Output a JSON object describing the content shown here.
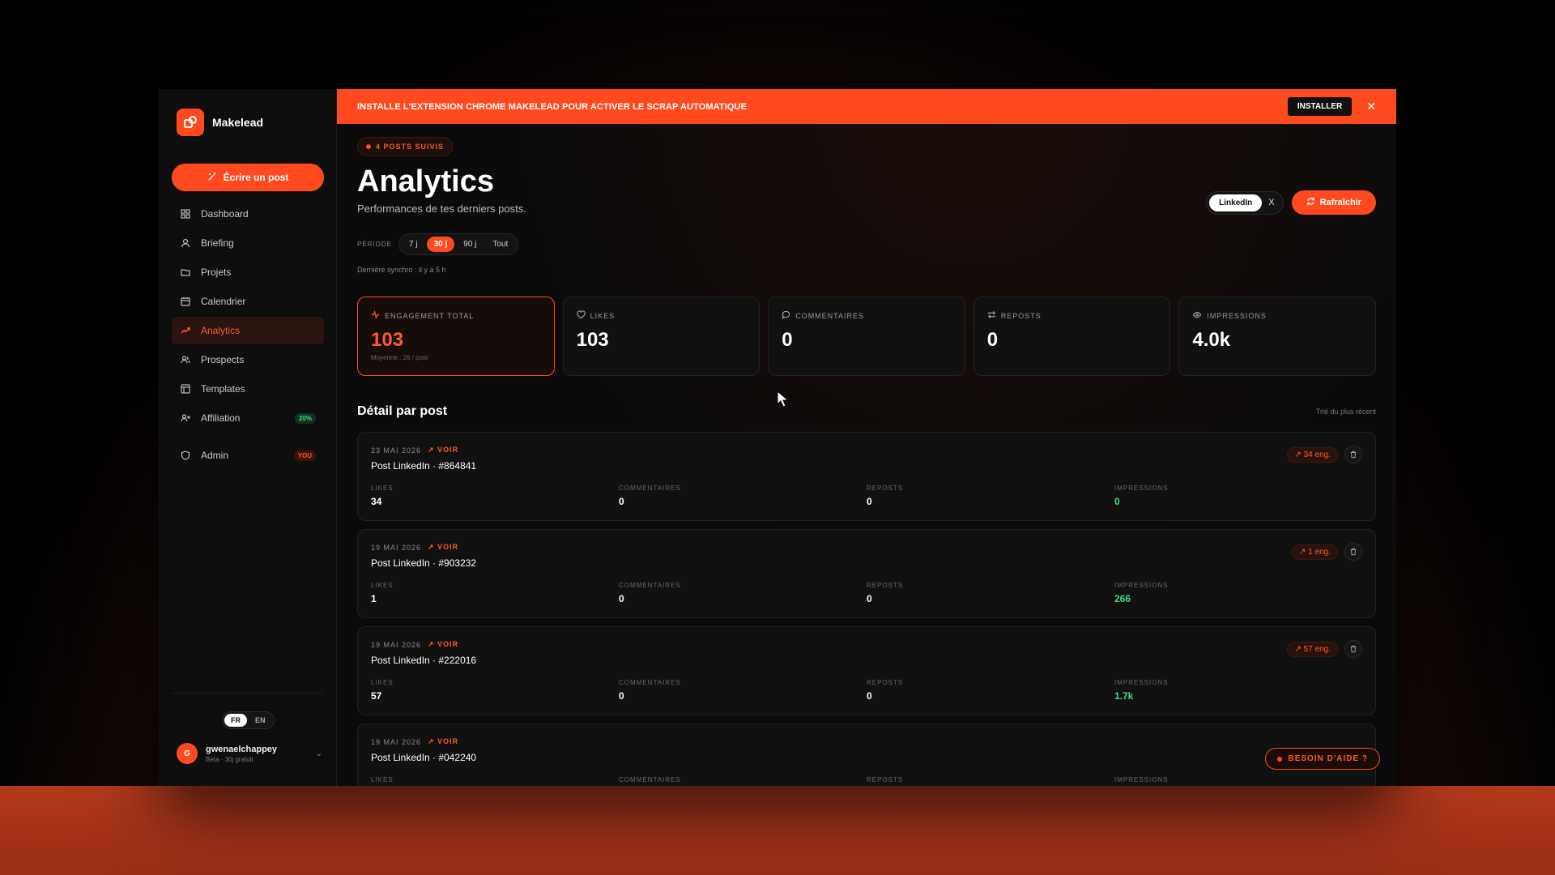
{
  "brand": {
    "name": "Makelead"
  },
  "sidebar": {
    "write_label": "Écrire un post",
    "items": [
      {
        "label": "Dashboard",
        "icon": "grid-icon"
      },
      {
        "label": "Briefing",
        "icon": "user-icon"
      },
      {
        "label": "Projets",
        "icon": "folder-icon"
      },
      {
        "label": "Calendrier",
        "icon": "calendar-icon"
      },
      {
        "label": "Analytics",
        "icon": "trend-icon",
        "active": true
      },
      {
        "label": "Prospects",
        "icon": "users-icon"
      },
      {
        "label": "Templates",
        "icon": "template-icon"
      },
      {
        "label": "Affiliation",
        "icon": "user-plus-icon",
        "badge": "20%"
      },
      {
        "label": "Admin",
        "icon": "shield-icon",
        "badge": "YOU"
      }
    ],
    "lang": {
      "fr": "FR",
      "en": "EN",
      "selected": "FR"
    },
    "user": {
      "initial": "G",
      "name": "gwenaelchappey",
      "plan": "Beta · 30j gratuit"
    }
  },
  "banner": {
    "text": "INSTALLE L'EXTENSION CHROME MAKELEAD POUR ACTIVER LE SCRAP AUTOMATIQUE",
    "install_label": "INSTALLER",
    "close": "✕"
  },
  "header": {
    "posts_badge": "4 POSTS SUIVIS",
    "title": "Analytics",
    "subtitle": "Performances de tes derniers posts.",
    "period_label": "PÉRIODE",
    "periods": [
      "7 j",
      "30 j",
      "90 j",
      "Tout"
    ],
    "selected_period": "30 j",
    "sync": "Dernière synchro : il y a 5 h",
    "platform": "LinkedIn",
    "platform_x": "X",
    "refresh_label": "Rafraîchir"
  },
  "stats": [
    {
      "label": "ENGAGEMENT TOTAL",
      "value": "103",
      "sub": "Moyenne : 26 / post",
      "icon": "activity-icon"
    },
    {
      "label": "LIKES",
      "value": "103",
      "icon": "heart-icon"
    },
    {
      "label": "COMMENTAIRES",
      "value": "0",
      "icon": "comment-icon"
    },
    {
      "label": "REPOSTS",
      "value": "0",
      "icon": "repost-icon"
    },
    {
      "label": "IMPRESSIONS",
      "value": "4.0k",
      "icon": "eye-icon"
    }
  ],
  "detail": {
    "title": "Détail par post",
    "sort": "Trié du plus récent"
  },
  "metric_labels": {
    "likes": "LIKES",
    "comments": "COMMENTAIRES",
    "reposts": "REPOSTS",
    "impressions": "IMPRESSIONS"
  },
  "posts": [
    {
      "date": "23 MAI 2026",
      "voir": "VOIR",
      "title": "Post LinkedIn · #864841",
      "eng": "34 eng.",
      "likes": "34",
      "comments": "0",
      "reposts": "0",
      "impressions": "0"
    },
    {
      "date": "19 MAI 2026",
      "voir": "VOIR",
      "title": "Post LinkedIn · #903232",
      "eng": "1 eng.",
      "likes": "1",
      "comments": "0",
      "reposts": "0",
      "impressions": "266"
    },
    {
      "date": "19 MAI 2026",
      "voir": "VOIR",
      "title": "Post LinkedIn · #222016",
      "eng": "57 eng.",
      "likes": "57",
      "comments": "0",
      "reposts": "0",
      "impressions": "1.7k"
    },
    {
      "date": "19 MAI 2026",
      "voir": "VOIR",
      "title": "Post LinkedIn · #042240",
      "eng": "",
      "likes": "",
      "comments": "",
      "reposts": "",
      "impressions": ""
    }
  ],
  "help_label": "BESOIN D'AIDE ?",
  "colors": {
    "accent": "#ff4a1f",
    "green": "#3ddc84",
    "bg": "#0b0b0b"
  }
}
